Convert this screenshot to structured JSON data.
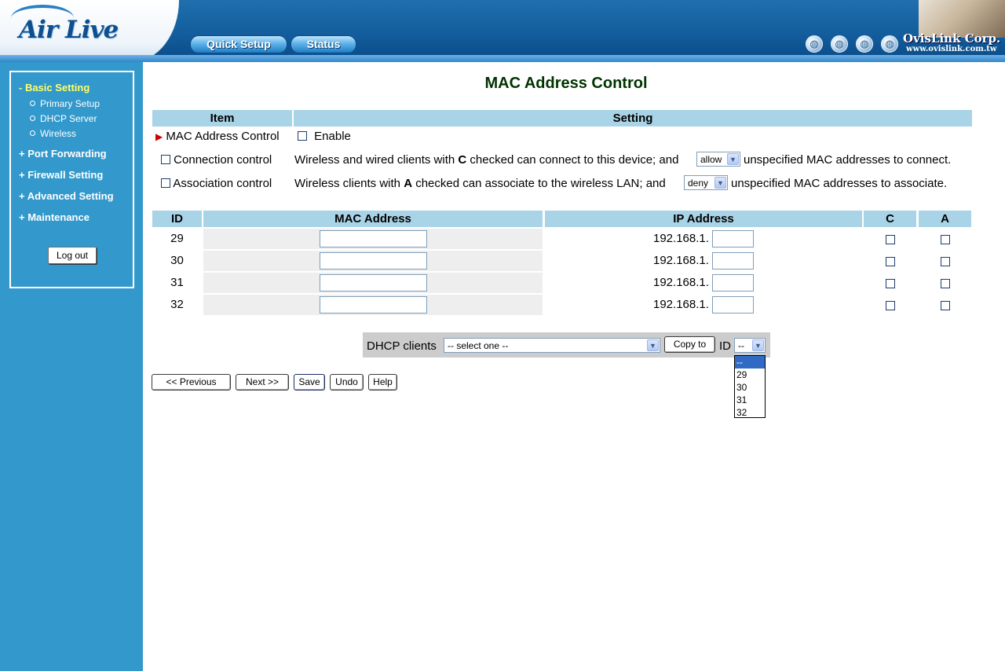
{
  "header": {
    "logo": "Air Live",
    "nav": [
      "Quick Setup",
      "Status"
    ],
    "brand_name": "OvisLink Corp.",
    "brand_url": "www.ovislink.com.tw",
    "globe_icon": "globe-icon",
    "colors": {
      "header_blue": "#135d9c",
      "sidebar_blue": "#3399cc",
      "table_header": "#a9d3e6",
      "active_menu": "#ffff66"
    }
  },
  "sidebar": {
    "basic": "- Basic Setting",
    "sub": [
      "Primary Setup",
      "DHCP Server",
      "Wireless"
    ],
    "items": [
      "+ Port Forwarding",
      "+ Firewall Setting",
      "+ Advanced Setting",
      "+ Maintenance"
    ],
    "logout": "Log out"
  },
  "main": {
    "title": "MAC Address Control",
    "settings_header": {
      "item": "Item",
      "setting": "Setting"
    },
    "mac_control": {
      "label": "MAC Address Control",
      "enable": "Enable"
    },
    "connection": {
      "label": "Connection control",
      "text_pre": "Wireless and wired clients with ",
      "text_bold": "C",
      "text_mid": " checked can connect to this device; and ",
      "select": "allow",
      "text_post": " unspecified MAC addresses to connect."
    },
    "association": {
      "label": "Association control",
      "text_pre": "Wireless clients with ",
      "text_bold": "A",
      "text_mid": " checked can associate to the wireless LAN; and ",
      "select": "deny",
      "text_post": " unspecified MAC addresses to associate."
    },
    "table_header": {
      "id": "ID",
      "mac": "MAC Address",
      "ip": "IP Address",
      "c": "C",
      "a": "A"
    },
    "rows": [
      {
        "id": "29",
        "ip_prefix": "192.168.1."
      },
      {
        "id": "30",
        "ip_prefix": "192.168.1."
      },
      {
        "id": "31",
        "ip_prefix": "192.168.1."
      },
      {
        "id": "32",
        "ip_prefix": "192.168.1."
      }
    ],
    "dhcp": {
      "label": "DHCP clients",
      "select": "-- select one --",
      "copy": "Copy to",
      "id_label": "ID",
      "id_select": "--",
      "id_options": [
        "--",
        "29",
        "30",
        "31",
        "32"
      ]
    },
    "buttons": {
      "previous": "<< Previous",
      "next": "Next >>",
      "save": "Save",
      "undo": "Undo",
      "help": "Help"
    }
  }
}
